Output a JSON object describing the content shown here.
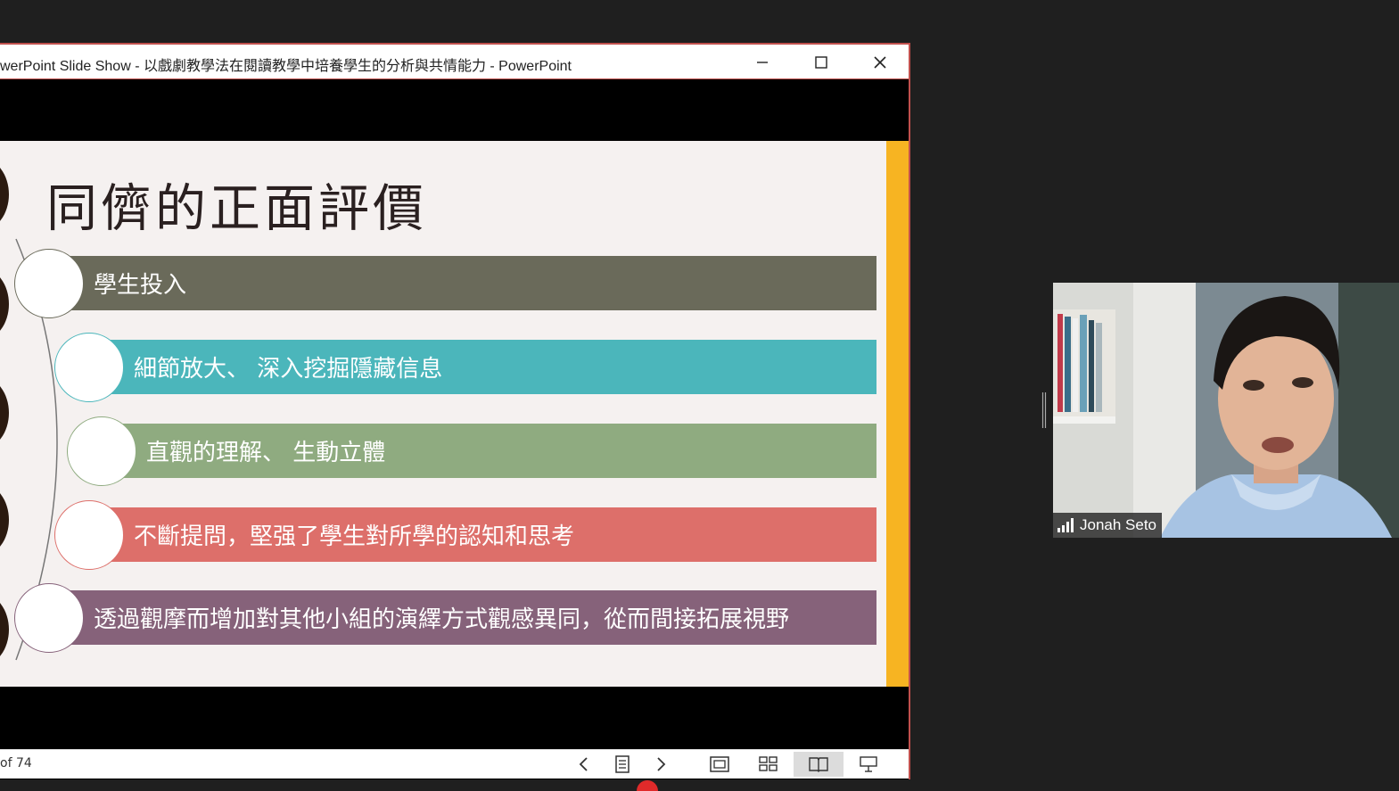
{
  "window": {
    "title": "werPoint Slide Show  -  以戲劇教學法在閱讀教學中培養學生的分析與共情能力 - PowerPoint"
  },
  "slide": {
    "title": "同儕的正面評價",
    "items": [
      {
        "text": "學生投入",
        "color": "#6a6a5a"
      },
      {
        "text": "細節放大、 深入挖掘隱藏信息",
        "color": "#4bb6bb"
      },
      {
        "text": "直觀的理解、 生動立體",
        "color": "#8fab80"
      },
      {
        "text": "不斷提問，堅强了學生對所學的認知和思考",
        "color": "#dd6f6a"
      },
      {
        "text": "透過觀摩而增加對其他小組的演繹方式觀感異同，從而間接拓展視野",
        "color": "#86627a"
      }
    ],
    "accent_color": "#f7b422"
  },
  "statusbar": {
    "slide_counter": "of 74"
  },
  "video": {
    "participant_name": "Jonah Seto"
  }
}
